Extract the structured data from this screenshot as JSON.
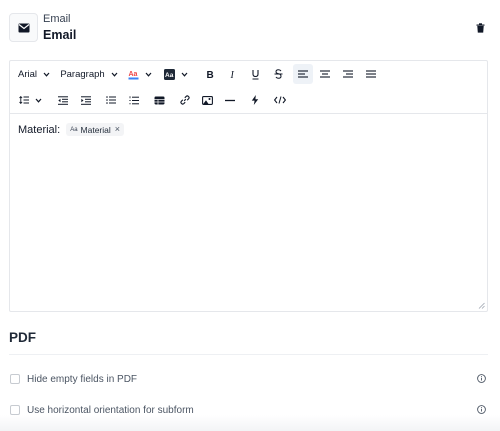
{
  "header": {
    "kicker": "Email",
    "title": "Email",
    "icon": "envelope-icon",
    "delete_icon": "trash-icon"
  },
  "editor": {
    "toolbar": {
      "font_family": "Arial",
      "block_format": "Paragraph",
      "font_color_icon": "text-color-icon",
      "bg_color_icon": "text-background-icon",
      "bg_color_glyph": "Aa",
      "bold_icon": "bold-icon",
      "italic_icon": "italic-icon",
      "underline_icon": "underline-icon",
      "strikethrough_icon": "strikethrough-icon",
      "align_left_icon": "align-left-icon",
      "align_center_icon": "align-center-icon",
      "align_right_icon": "align-right-icon",
      "align_justify_icon": "align-justify-icon",
      "active_alignment": "left",
      "line_height_icon": "line-height-icon",
      "outdent_icon": "outdent-icon",
      "indent_icon": "indent-icon",
      "bullet_list_icon": "bullet-list-icon",
      "numbered_list_icon": "numbered-list-icon",
      "table_icon": "table-icon",
      "link_icon": "link-icon",
      "image_icon": "image-icon",
      "hr_icon": "horizontal-rule-icon",
      "lightning_icon": "lightning-icon",
      "code_icon": "code-icon"
    },
    "content": {
      "label": "Material:",
      "chip": {
        "prefix": "Aa",
        "text": "Material",
        "remove": "×"
      }
    }
  },
  "pdf": {
    "title": "PDF",
    "options": [
      {
        "label": "Hide empty fields in PDF",
        "checked": false
      },
      {
        "label": "Use horizontal orientation for subform",
        "checked": false
      }
    ]
  },
  "colors": {
    "text": "#111827",
    "border": "#e5e7eb",
    "active_bg": "#eef2f7",
    "font_color_a": "#ef4444",
    "font_color_bar": "#3b82f6",
    "muted": "#4b5563"
  }
}
